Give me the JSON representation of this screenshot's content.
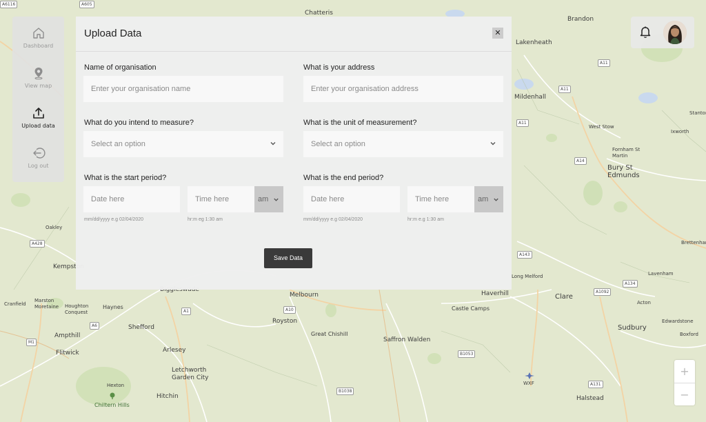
{
  "sidebar": {
    "items": [
      {
        "label": "Dashboard",
        "icon": "home-icon"
      },
      {
        "label": "View map",
        "icon": "map-pin-icon"
      },
      {
        "label": "Upload data",
        "icon": "upload-icon"
      },
      {
        "label": "Log out",
        "icon": "logout-icon"
      }
    ]
  },
  "modal": {
    "title": "Upload Data",
    "close_label": "✕",
    "org_name": {
      "label": "Name of organisation",
      "placeholder": "Enter your organisation name"
    },
    "address": {
      "label": "What is your address",
      "placeholder": "Enter your organisation address"
    },
    "measure": {
      "label": "What do you intend to measure?",
      "selected": "Select an option"
    },
    "unit": {
      "label": "What is the unit of measurement?",
      "selected": "Select an option"
    },
    "start": {
      "label": "What is the start period?",
      "date_placeholder": "Date here",
      "time_placeholder": "Time here",
      "ampm": "am",
      "date_hint": "mm/dd/yyyy e.g 02/04/2020",
      "time_hint": "hr:m  eg 1:30 am"
    },
    "end": {
      "label": "What is the end period?",
      "date_placeholder": "Date here",
      "time_placeholder": "Time here",
      "ampm": "am",
      "date_hint": "mm/dd/yyyy e.g 02/04/2020",
      "time_hint": "hr:m  e.g 1:30 am"
    },
    "save_label": "Save Data"
  },
  "zoom": {
    "in_label": "+",
    "out_label": "−"
  },
  "map": {
    "places": [
      "Chatteris",
      "Brandon",
      "Lakenheath",
      "Mildenhall",
      "West Stow",
      "Ixworth",
      "Fornham St Martin",
      "Bury St Edmunds",
      "Stanton",
      "Oakley",
      "Kempston",
      "Biggleswade",
      "Melbourn",
      "Haverhill",
      "Clare",
      "Castle Camps",
      "Royston",
      "Great Chishill",
      "Saffron Walden",
      "Cranfield",
      "Marston Moretaine",
      "Houghton Conquest",
      "Haynes",
      "Shefford",
      "Ampthill",
      "Flitwick",
      "Arlesey",
      "Letchworth Garden City",
      "Hexton",
      "Chiltern Hills",
      "Hitchin",
      "Sudbury",
      "Acton",
      "Edwardstone",
      "Boxford",
      "Lavenham",
      "Brettenham",
      "Halstead",
      "WXF",
      "Long Melford"
    ],
    "roads": [
      "A605",
      "A11",
      "A11",
      "A11",
      "A14",
      "A428",
      "A143",
      "A134",
      "A1092",
      "A10",
      "A1",
      "A6",
      "M1",
      "A1",
      "B1053",
      "B1038",
      "A131",
      "A6116"
    ]
  }
}
